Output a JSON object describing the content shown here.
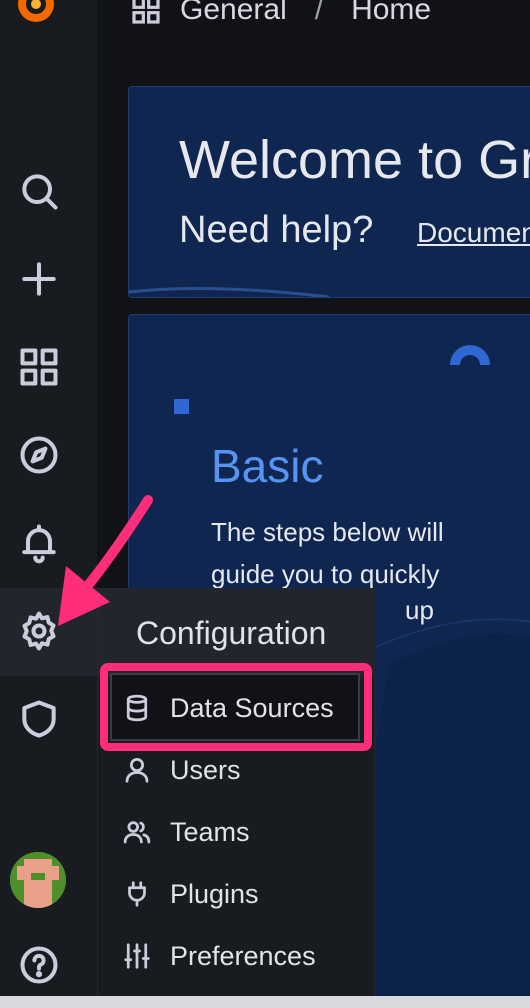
{
  "breadcrumb": {
    "folder": "General",
    "separator": "/",
    "page": "Home"
  },
  "welcome": {
    "title": "Welcome to Gr",
    "help": "Need help?",
    "docs_link": "Documen"
  },
  "basic_panel": {
    "title": "Basic",
    "description": "The steps below will guide you to quickly",
    "description_tail": "up"
  },
  "sidebar": {
    "items": [
      {
        "name": "search",
        "icon": "search-icon"
      },
      {
        "name": "create",
        "icon": "plus-icon"
      },
      {
        "name": "dashboards",
        "icon": "grid-icon"
      },
      {
        "name": "explore",
        "icon": "compass-icon"
      },
      {
        "name": "alerting",
        "icon": "bell-icon"
      },
      {
        "name": "configuration",
        "icon": "gear-icon",
        "active": true
      },
      {
        "name": "server-admin",
        "icon": "shield-icon"
      },
      {
        "name": "profile",
        "icon": "avatar"
      },
      {
        "name": "help",
        "icon": "help-icon"
      }
    ]
  },
  "config_menu": {
    "title": "Configuration",
    "items": [
      {
        "label": "Data Sources",
        "icon": "database-icon",
        "highlighted": true
      },
      {
        "label": "Users",
        "icon": "user-icon"
      },
      {
        "label": "Teams",
        "icon": "users-icon"
      },
      {
        "label": "Plugins",
        "icon": "plug-icon"
      },
      {
        "label": "Preferences",
        "icon": "sliders-icon"
      }
    ]
  },
  "colors": {
    "accent_highlight": "#ff2d7a",
    "panel_blue": "#0f2651",
    "link_blue": "#5794f2"
  }
}
